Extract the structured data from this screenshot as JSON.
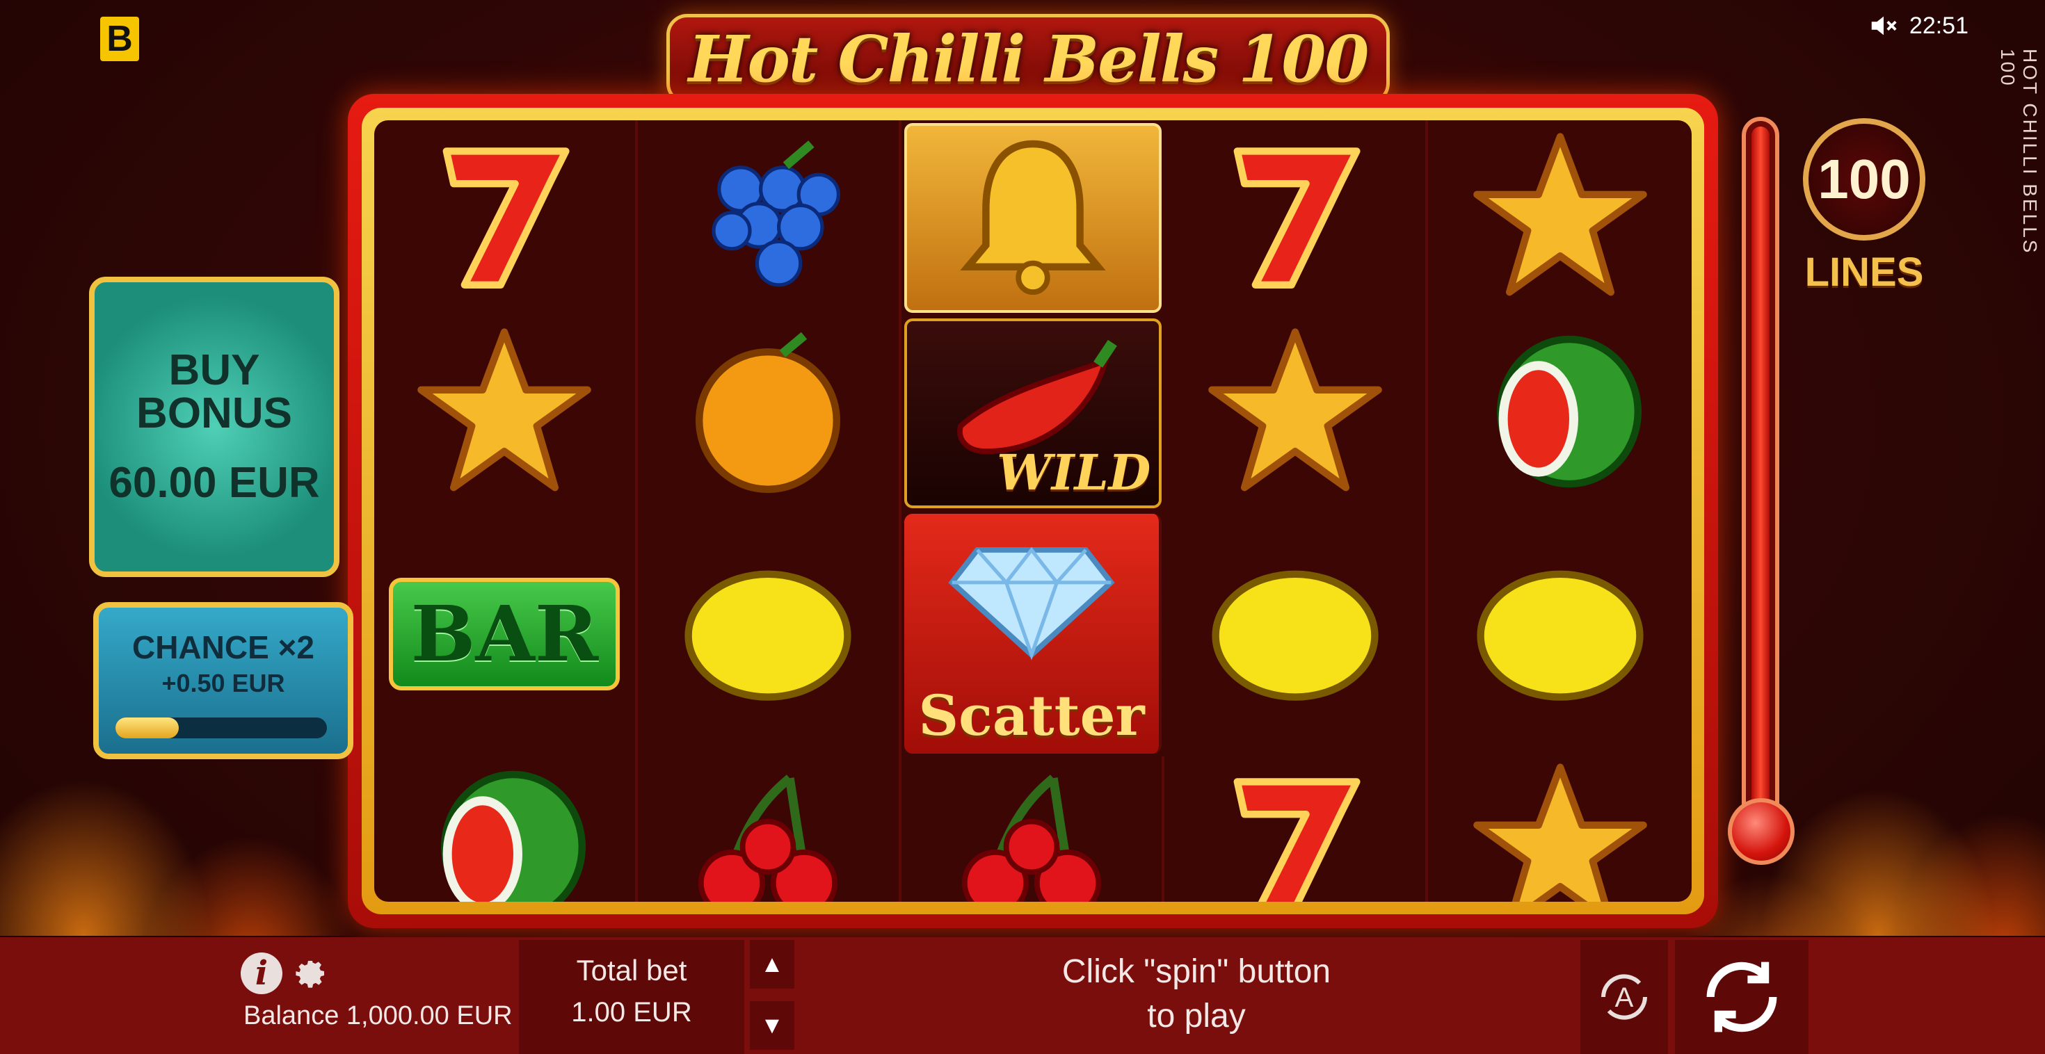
{
  "header": {
    "brand_letter": "B",
    "game_title": "Hot Chilli Bells 100",
    "clock": "22:51",
    "side_title": "HOT CHILLI BELLS 100"
  },
  "buy_bonus": {
    "line1": "BUY BONUS",
    "line2": "60.00 EUR"
  },
  "chance": {
    "title": "CHANCE ×2",
    "subtitle": "+0.50 EUR",
    "level_fraction": 0.3
  },
  "lines_badge": {
    "count": "100",
    "label": "LINES"
  },
  "reels": {
    "grid": [
      [
        "seven",
        "grapes",
        "bell",
        "seven",
        "star"
      ],
      [
        "star",
        "orange",
        "wild",
        "star",
        "watermelon"
      ],
      [
        "bar",
        "lemon",
        "scatter",
        "lemon",
        "lemon"
      ],
      [
        "watermelon",
        "cherries",
        "cherries",
        "seven",
        "star"
      ]
    ],
    "wild_label": "WILD",
    "scatter_label": "Scatter",
    "bar_label": "BAR"
  },
  "bottom_bar": {
    "balance": "Balance 1,000.00 EUR",
    "total_bet_label": "Total bet",
    "total_bet_value": "1.00 EUR",
    "message_line1": "Click \"spin\" button",
    "message_line2": "to play",
    "auto_label": "A"
  },
  "colors": {
    "background": "#2e0605",
    "reel_frame": "#e61b12",
    "gold": "#f6c53b",
    "bottom_bar": "#7a0e0c"
  }
}
